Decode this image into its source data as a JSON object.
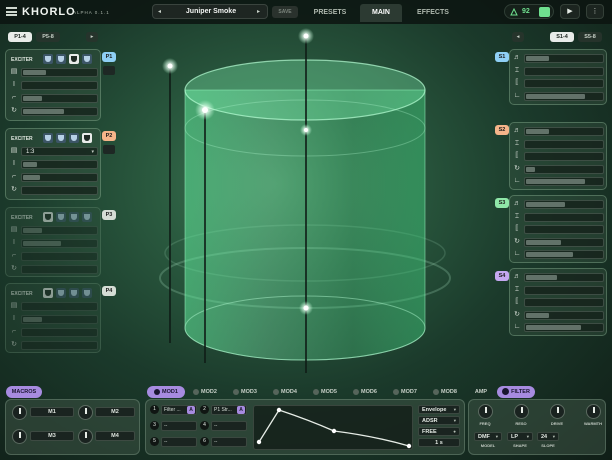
{
  "header": {
    "logo": "KHORLO",
    "version": "ALPHA 0.1.1",
    "preset_name": "Juniper Smoke",
    "preset_prev": "◂",
    "preset_next": "▸",
    "save_label": "SAVE",
    "tabs": [
      {
        "label": "PRESETS",
        "active": false
      },
      {
        "label": "MAIN",
        "active": true
      },
      {
        "label": "EFFECTS",
        "active": false
      }
    ],
    "voice_count": "92",
    "play_icon": "▶",
    "settings_icon": "⋮"
  },
  "left_pages": {
    "p1": "P1-4",
    "p2": "P5-8",
    "arrow": "▸"
  },
  "right_pages": {
    "arrow": "◂",
    "s1": "S1-4",
    "s2": "S5-8"
  },
  "exciters": [
    {
      "title": "EXCITER",
      "tag": "P1",
      "color": "#8fd0f5",
      "dropdown": "",
      "dim": false,
      "fills": [
        0.3,
        0.0,
        0.25,
        0.55
      ],
      "selected_shape": 2
    },
    {
      "title": "EXCITER",
      "tag": "P2",
      "color": "#f5b58a",
      "dropdown": "1:3",
      "dim": false,
      "fills": [
        0.18,
        0.22,
        0.0
      ],
      "selected_shape": 3
    },
    {
      "title": "EXCITER",
      "tag": "P3",
      "color": "#d5ddd5",
      "dropdown": "",
      "dim": true,
      "fills": [
        0.25,
        0.5,
        0.0
      ],
      "selected_shape": 0
    },
    {
      "title": "EXCITER",
      "tag": "P4",
      "color": "#d5ddd5",
      "dropdown": "",
      "dim": true,
      "fills": [
        0.0,
        0.25,
        0.0
      ],
      "selected_shape": 0
    }
  ],
  "strings": [
    {
      "tag": "S1",
      "color": "#8fd0f5"
    },
    {
      "tag": "S2",
      "color": "#f5b58a"
    },
    {
      "tag": "S3",
      "color": "#8fe6a8"
    },
    {
      "tag": "S4",
      "color": "#c5a8f0"
    }
  ],
  "macros": {
    "title": "MACROS",
    "items": [
      "M1",
      "M2",
      "M3",
      "M4"
    ]
  },
  "mod_tabs": [
    "MOD1",
    "MOD2",
    "MOD3",
    "MOD4",
    "MOD5",
    "MOD6",
    "MOD7",
    "MOD8"
  ],
  "mod_slots": [
    {
      "num": "1",
      "label": "Filter ...",
      "badge": "A"
    },
    {
      "num": "2",
      "label": "P1 Str...",
      "badge": "A"
    },
    {
      "num": "3",
      "label": "--",
      "badge": ""
    },
    {
      "num": "4",
      "label": "--",
      "badge": ""
    },
    {
      "num": "5",
      "label": "--",
      "badge": ""
    },
    {
      "num": "6",
      "label": "--",
      "badge": ""
    }
  ],
  "env_options": {
    "type": "Envelope",
    "mode": "ADSR",
    "sync": "FREE",
    "time": "1 s"
  },
  "filter": {
    "amp_tab": "AMP",
    "filter_tab": "FILTER",
    "knobs": [
      "FREQ",
      "RESO",
      "DRIVE",
      "WARMTH"
    ],
    "model": {
      "value": "DMF",
      "label": "MODEL"
    },
    "shape": {
      "value": "LP",
      "label": "SHAPE"
    },
    "slope": {
      "value": "24",
      "label": "SLOPE"
    }
  }
}
